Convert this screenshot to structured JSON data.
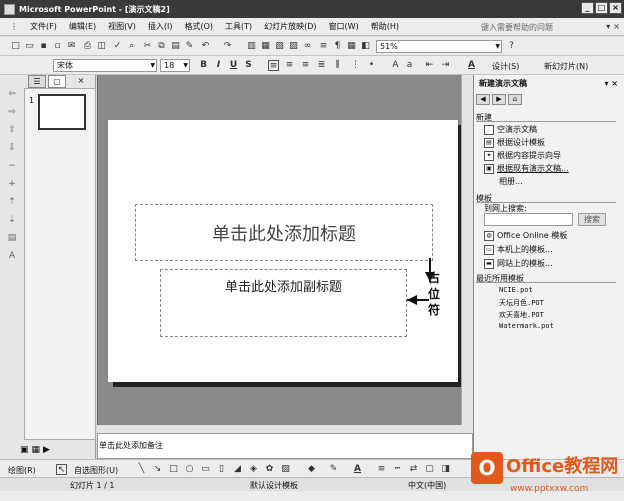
{
  "window": {
    "title": "Microsoft PowerPoint - [演示文稿2]"
  },
  "menubar": {
    "items": [
      "文件(F)",
      "编辑(E)",
      "视图(V)",
      "插入(I)",
      "格式(O)",
      "工具(T)",
      "幻灯片放映(D)",
      "窗口(W)",
      "帮助(H)"
    ],
    "help_placeholder": "键入需要帮助的问题"
  },
  "toolbar": {
    "zoom": "51%",
    "font_name": "宋体",
    "font_size": "18",
    "bold": "B",
    "italic": "I",
    "underline": "U",
    "shadow": "S",
    "design_label": "设计(S)",
    "new_slide_label": "新幻灯片(N)"
  },
  "left_pane": {
    "slide_number": "1"
  },
  "slide": {
    "title_placeholder": "单击此处添加标题",
    "subtitle_placeholder": "单击此处添加副标题"
  },
  "notes": {
    "placeholder": "单击此处添加备注"
  },
  "annotation": {
    "callout_text": "占位符"
  },
  "task_pane": {
    "title": "新建演示文稿",
    "section_new": "新建",
    "new_items": [
      "空演示文稿",
      "根据设计模板",
      "根据内容提示向导",
      "根据现有演示文稿...",
      "相册..."
    ],
    "section_templates": "模板",
    "search_label": "到网上搜索:",
    "search_button": "搜索",
    "template_items": [
      "Office Online 模板",
      "本机上的模板...",
      "网站上的模板..."
    ],
    "section_recent": "最近所用模板",
    "recent_items": [
      "NCIE.pot",
      "天坛月色.POT",
      "欢天喜地.POT",
      "Watermark.pot"
    ]
  },
  "drawbar": {
    "draw_label": "绘图(R)",
    "autoshapes_label": "自选图形(U)"
  },
  "statusbar": {
    "slide_info": "幻灯片 1 / 1",
    "design": "默认设计模板",
    "language": "中文(中国)"
  },
  "watermark": {
    "brand": "Office教程网",
    "url": "www.pptxxw.com",
    "logo": "O"
  },
  "colors": {
    "brand_orange": "#e15a1c"
  }
}
